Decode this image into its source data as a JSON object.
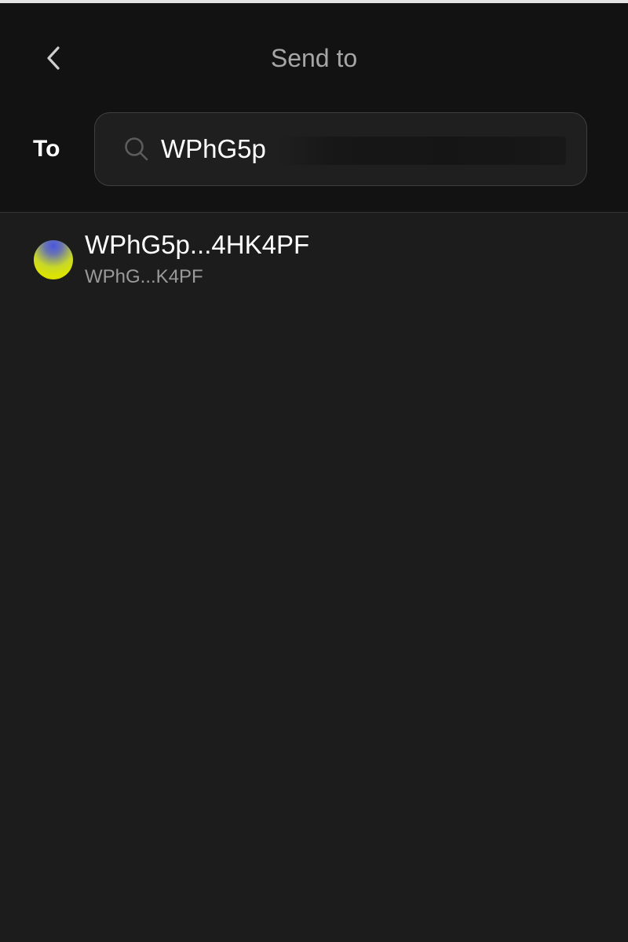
{
  "header": {
    "title": "Send to",
    "back_icon": "chevron-left-icon"
  },
  "recipient": {
    "label": "To",
    "search_icon": "search-icon",
    "input_value": "WPhG5p"
  },
  "results": [
    {
      "title": "WPhG5p...4HK4PF",
      "subtitle": "WPhG...K4PF",
      "avatar_colors": [
        "#4a55e0",
        "#dde400"
      ]
    }
  ],
  "colors": {
    "background": "#1c1c1c",
    "header_background": "#121212",
    "title_text": "#a6a6a6",
    "secondary_text": "#9a9a9a",
    "input_border": "#3f3f3f"
  }
}
